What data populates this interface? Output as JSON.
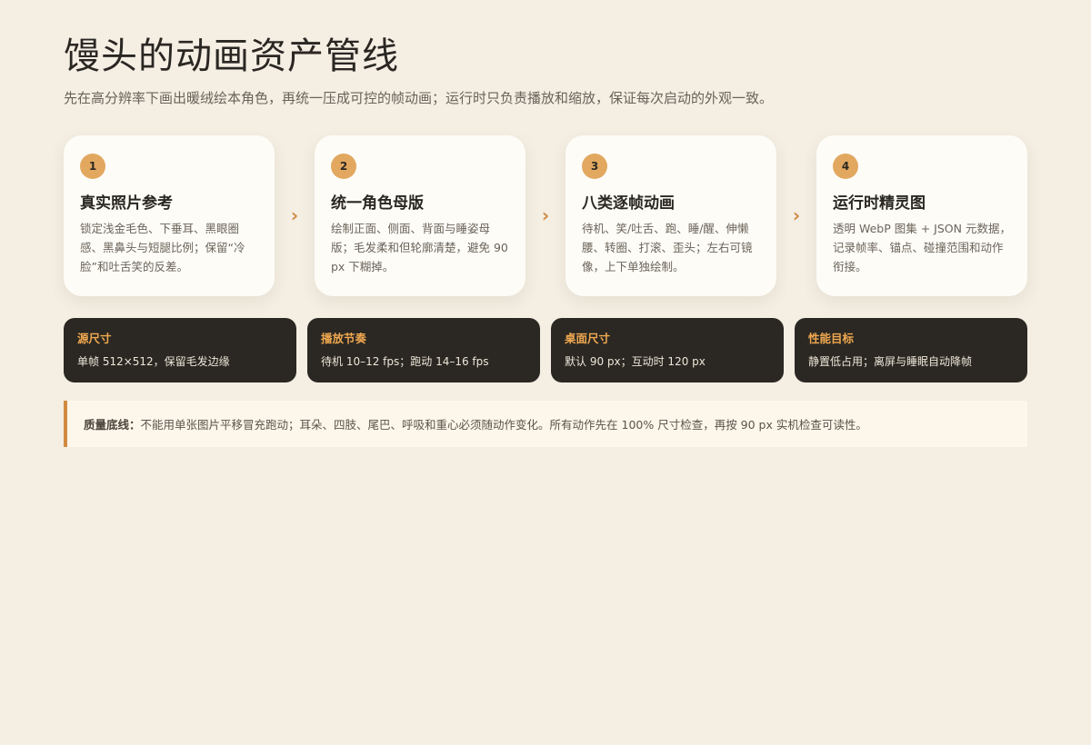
{
  "header": {
    "title": "馒头的动画资产管线",
    "subtitle": "先在高分辨率下画出暖绒绘本角色，再统一压成可控的帧动画；运行时只负责播放和缩放，保证每次启动的外观一致。"
  },
  "steps": [
    {
      "number": "1",
      "title": "真实照片参考",
      "description": "锁定浅金毛色、下垂耳、黑眼圈感、黑鼻头与短腿比例；保留“冷脸”和吐舌笑的反差。"
    },
    {
      "number": "2",
      "title": "统一角色母版",
      "description": "绘制正面、侧面、背面与睡姿母版；毛发柔和但轮廓清楚，避免 90 px 下糊掉。"
    },
    {
      "number": "3",
      "title": "八类逐帧动画",
      "description": "待机、笑/吐舌、跑、睡/醒、伸懒腰、转圈、打滚、歪头；左右可镜像，上下单独绘制。"
    },
    {
      "number": "4",
      "title": "运行时精灵图",
      "description": "透明 WebP 图集 + JSON 元数据，记录帧率、锚点、碰撞范围和动作衔接。"
    }
  ],
  "arrow_glyph": "›",
  "metrics": [
    {
      "label": "源尺寸",
      "value": "单帧 512×512，保留毛发边缘"
    },
    {
      "label": "播放节奏",
      "value": "待机 10–12 fps；跑动 14–16 fps"
    },
    {
      "label": "桌面尺寸",
      "value": "默认 90 px；互动时 120 px"
    },
    {
      "label": "性能目标",
      "value": "静置低占用；离屏与睡眠自动降帧"
    }
  ],
  "note": {
    "label": "质量底线：",
    "text": "不能用单张图片平移冒充跑动；耳朵、四肢、尾巴、呼吸和重心必须随动作变化。所有动作先在 100% 尺寸检查，再按 90 px 实机检查可读性。"
  },
  "colors": {
    "background": "#f4eee3",
    "card": "#fdfcf7",
    "accent": "#e2a860",
    "arrow": "#d08a42",
    "dark_card": "#2b2823",
    "metric_label": "#f0a850",
    "note_background": "#fdf6ea"
  }
}
